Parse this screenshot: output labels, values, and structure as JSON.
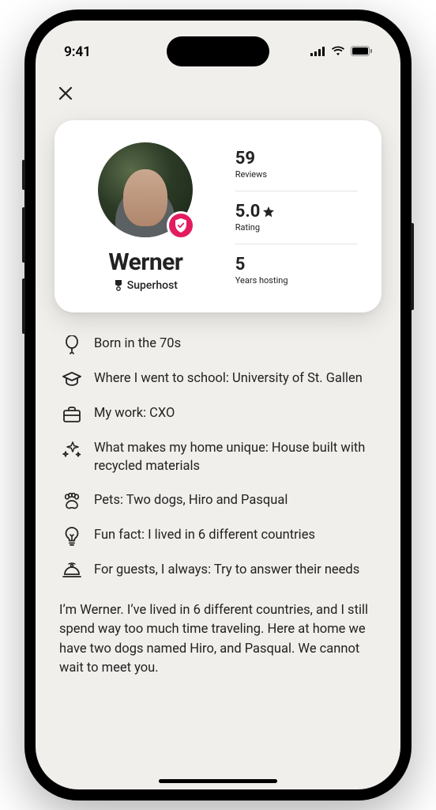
{
  "status": {
    "time": "9:41"
  },
  "profile": {
    "name": "Werner",
    "superhost_label": "Superhost",
    "stats": {
      "reviews": {
        "value": "59",
        "label": "Reviews"
      },
      "rating": {
        "value": "5.0",
        "label": "Rating"
      },
      "years": {
        "value": "5",
        "label": "Years hosting"
      }
    }
  },
  "details": [
    {
      "icon": "balloon",
      "text": "Born in the 70s"
    },
    {
      "icon": "gradcap",
      "text": "Where I went to school: University of St. Gallen"
    },
    {
      "icon": "briefcase",
      "text": "My work: CXO"
    },
    {
      "icon": "sparkles",
      "text": "What makes my home unique: House built with recycled materials"
    },
    {
      "icon": "paw",
      "text": "Pets: Two dogs, Hiro and Pasqual"
    },
    {
      "icon": "bulb",
      "text": "Fun fact: I lived in 6 different countries"
    },
    {
      "icon": "cloche",
      "text": "For guests, I always: Try to answer their needs"
    }
  ],
  "bio": "I’m Werner. I’ve lived in 6 different countries, and I still spend way too much time traveling. Here at home we have two dogs named Hiro, and Pasqual. We cannot wait to meet you."
}
